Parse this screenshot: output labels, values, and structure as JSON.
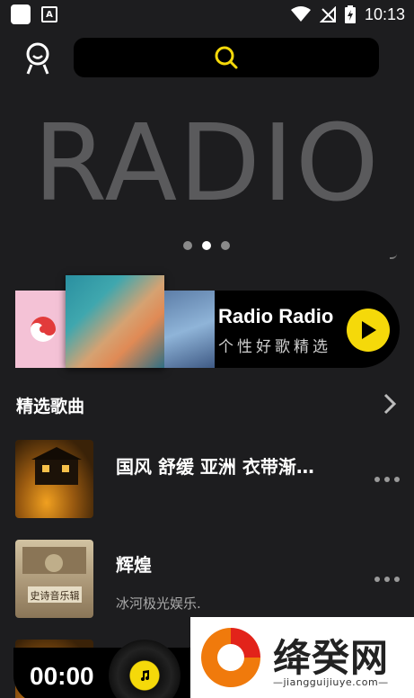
{
  "status_bar": {
    "time": "10:13",
    "notif_icon_letter": "A"
  },
  "header": {
    "search_icon": "search-icon",
    "avatar_icon": "smile-user-icon"
  },
  "banner": {
    "text": "RADIO",
    "active_dot": 1,
    "dot_count": 3
  },
  "radio_card": {
    "title": "Radio Radio",
    "subtitle": "个性好歌精选"
  },
  "section": {
    "title": "精选歌曲"
  },
  "songs": [
    {
      "title": "国风 舒缓 亚洲 衣带渐…",
      "subtitle": ""
    },
    {
      "title": "辉煌",
      "subtitle": "冰河极光娱乐.",
      "cover_text": "史诗音乐辑"
    }
  ],
  "player": {
    "time": "00:00"
  },
  "watermark": {
    "name": "绛癸网",
    "url": "—jiangguijiuye.com—"
  },
  "colors": {
    "accent": "#f5d90a",
    "background": "#1d1d1f"
  }
}
